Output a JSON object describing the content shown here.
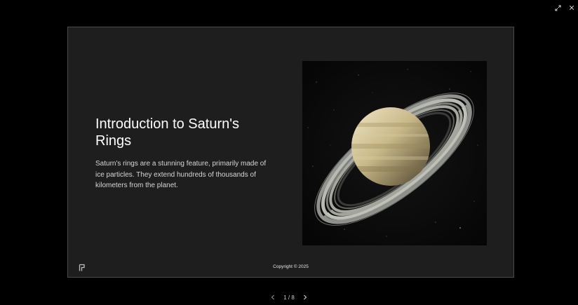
{
  "viewer": {
    "background": "#000000",
    "controls": {
      "fullscreen_icon": "expand-icon",
      "close_icon": "close-icon"
    }
  },
  "slide": {
    "title": "Introduction to Saturn's Rings",
    "body": "Saturn's rings are a stunning feature, primarily made of ice particles. They extend hundreds of thousands of kilometers from the planet.",
    "image_subject": "saturn-image",
    "footer": {
      "logo_icon": "presentation-logo-icon",
      "copyright": "Copyright © 2025"
    },
    "colors": {
      "background": "#1e1e1e",
      "title": "#ffffff",
      "body": "#d6d6d6"
    }
  },
  "pagination": {
    "prev_icon": "chevron-left-icon",
    "next_icon": "chevron-right-icon",
    "label": "1 / 8"
  }
}
